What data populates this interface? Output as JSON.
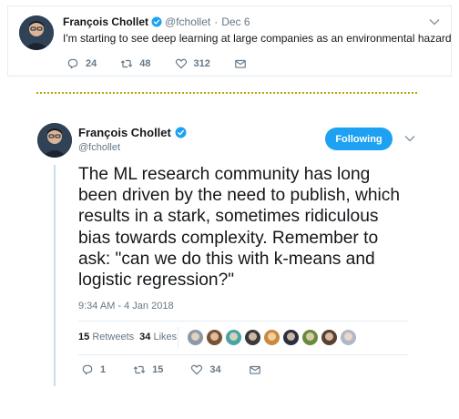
{
  "top_tweet": {
    "name": "François Chollet",
    "handle": "@fchollet",
    "separator": "·",
    "date": "Dec 6",
    "text": "I'm starting to see deep learning at large companies as an environmental hazard",
    "replies": "24",
    "retweets": "48",
    "likes": "312"
  },
  "main_tweet": {
    "name": "François Chollet",
    "handle": "@fchollet",
    "follow_label": "Following",
    "text": "The ML research community has long been driven by the need to publish, which results in a stark, sometimes ridiculous bias towards complexity. Remember to ask: \"can we do this with k-means and logistic regression?\"",
    "timestamp": "9:34 AM - 4 Jan 2018",
    "retweet_count": "15",
    "retweet_label": "Retweets",
    "like_count": "34",
    "like_label": "Likes",
    "replies": "1",
    "retweets": "15",
    "likes": "34"
  },
  "colors": {
    "accent": "#1da1f2",
    "muted": "#657786",
    "divider": "#b9a300"
  },
  "likers": [
    {
      "color": "#8a9aa8"
    },
    {
      "color": "#7a5230"
    },
    {
      "color": "#4ba3a0"
    },
    {
      "color": "#3a3a3a"
    },
    {
      "color": "#c98a3c"
    },
    {
      "color": "#2a3040"
    },
    {
      "color": "#6a8a40"
    },
    {
      "color": "#5a4030"
    },
    {
      "color": "#b0b8c8"
    }
  ]
}
